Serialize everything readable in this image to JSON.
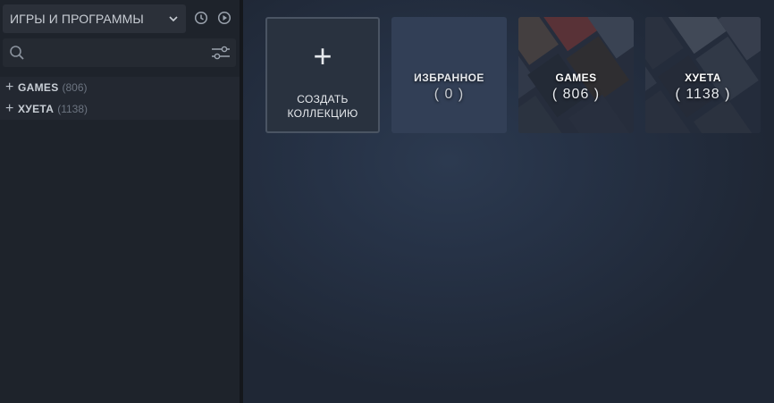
{
  "sidebar": {
    "filter_label": "ИГРЫ И ПРОГРАММЫ",
    "search": {
      "value": "",
      "placeholder": ""
    },
    "collections": [
      {
        "name": "GAMES",
        "count": "(806)"
      },
      {
        "name": "ХУЕТА",
        "count": "(1138)"
      }
    ]
  },
  "main": {
    "create_tile": {
      "plus": "+",
      "line1": "СОЗДАТЬ",
      "line2": "КОЛЛЕКЦИЮ"
    },
    "tiles": [
      {
        "title": "ИЗБРАННОЕ",
        "count": "( 0 )"
      },
      {
        "title": "GAMES",
        "count": "( 806 )"
      },
      {
        "title": "ХУЕТА",
        "count": "( 1138 )"
      }
    ]
  },
  "colors": {
    "sidebar_bg": "#1e232b",
    "main_bg": "#263246",
    "tile_fav_bg": "#323f56",
    "text_primary": "#e6e9ed"
  }
}
